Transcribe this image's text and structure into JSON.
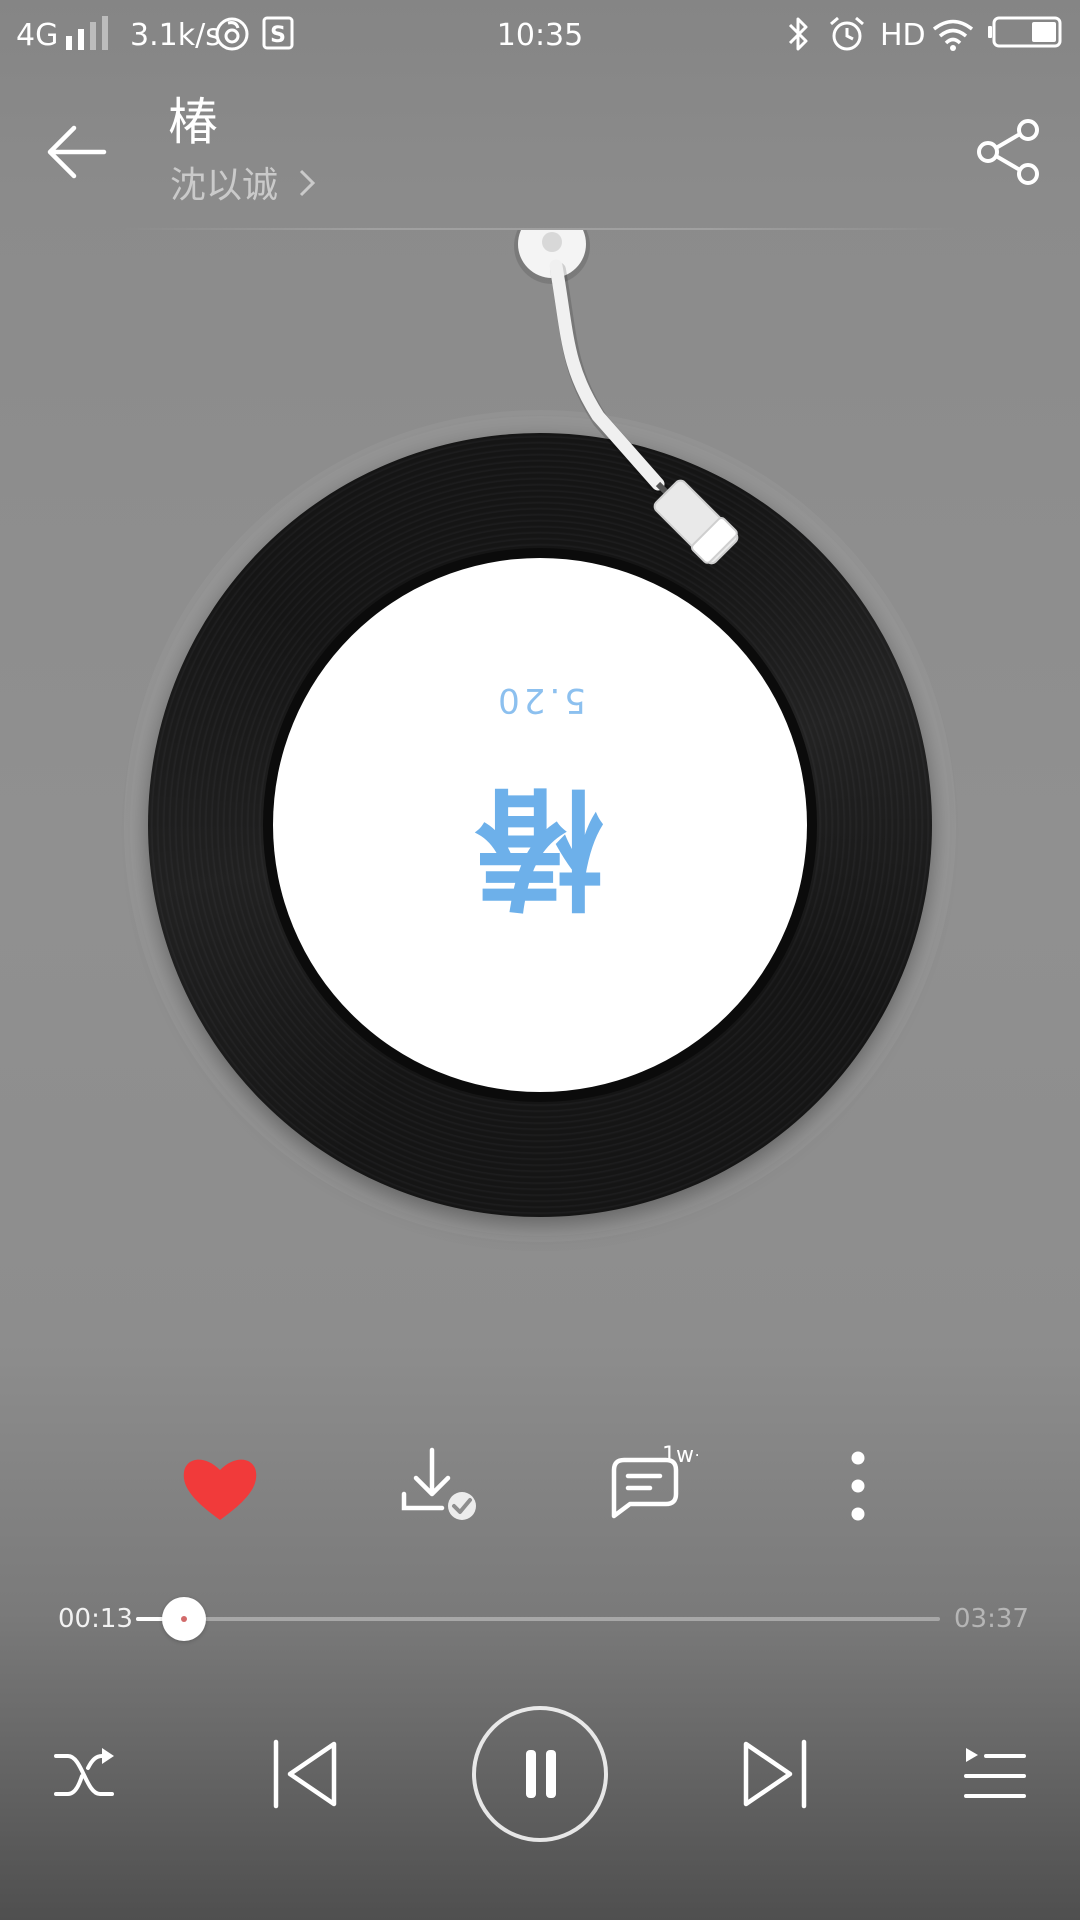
{
  "status_bar": {
    "network": "4G",
    "speed": "3.1k/s",
    "time": "10:35",
    "hd": "HD",
    "icons": [
      "signal-icon",
      "netease-icon",
      "s-app-icon",
      "bluetooth-icon",
      "alarm-icon",
      "wifi-icon",
      "battery-icon"
    ]
  },
  "header": {
    "title": "椿",
    "artist": "沈以诚",
    "icons": [
      "back-arrow-icon",
      "chevron-right-icon",
      "share-icon"
    ]
  },
  "disc": {
    "label_title": "椿",
    "label_date": "5.20",
    "label_color": "#6db0ea"
  },
  "actions": {
    "comment_badge": "1w+",
    "like_color": "#f13a3a",
    "icons": [
      "heart-icon",
      "download-done-icon",
      "comment-icon",
      "more-vertical-icon"
    ]
  },
  "progress": {
    "elapsed": "00:13",
    "total": "03:37",
    "fraction": 0.06
  },
  "controls": {
    "icons": [
      "shuffle-icon",
      "previous-icon",
      "pause-icon",
      "next-icon",
      "playlist-icon"
    ]
  }
}
